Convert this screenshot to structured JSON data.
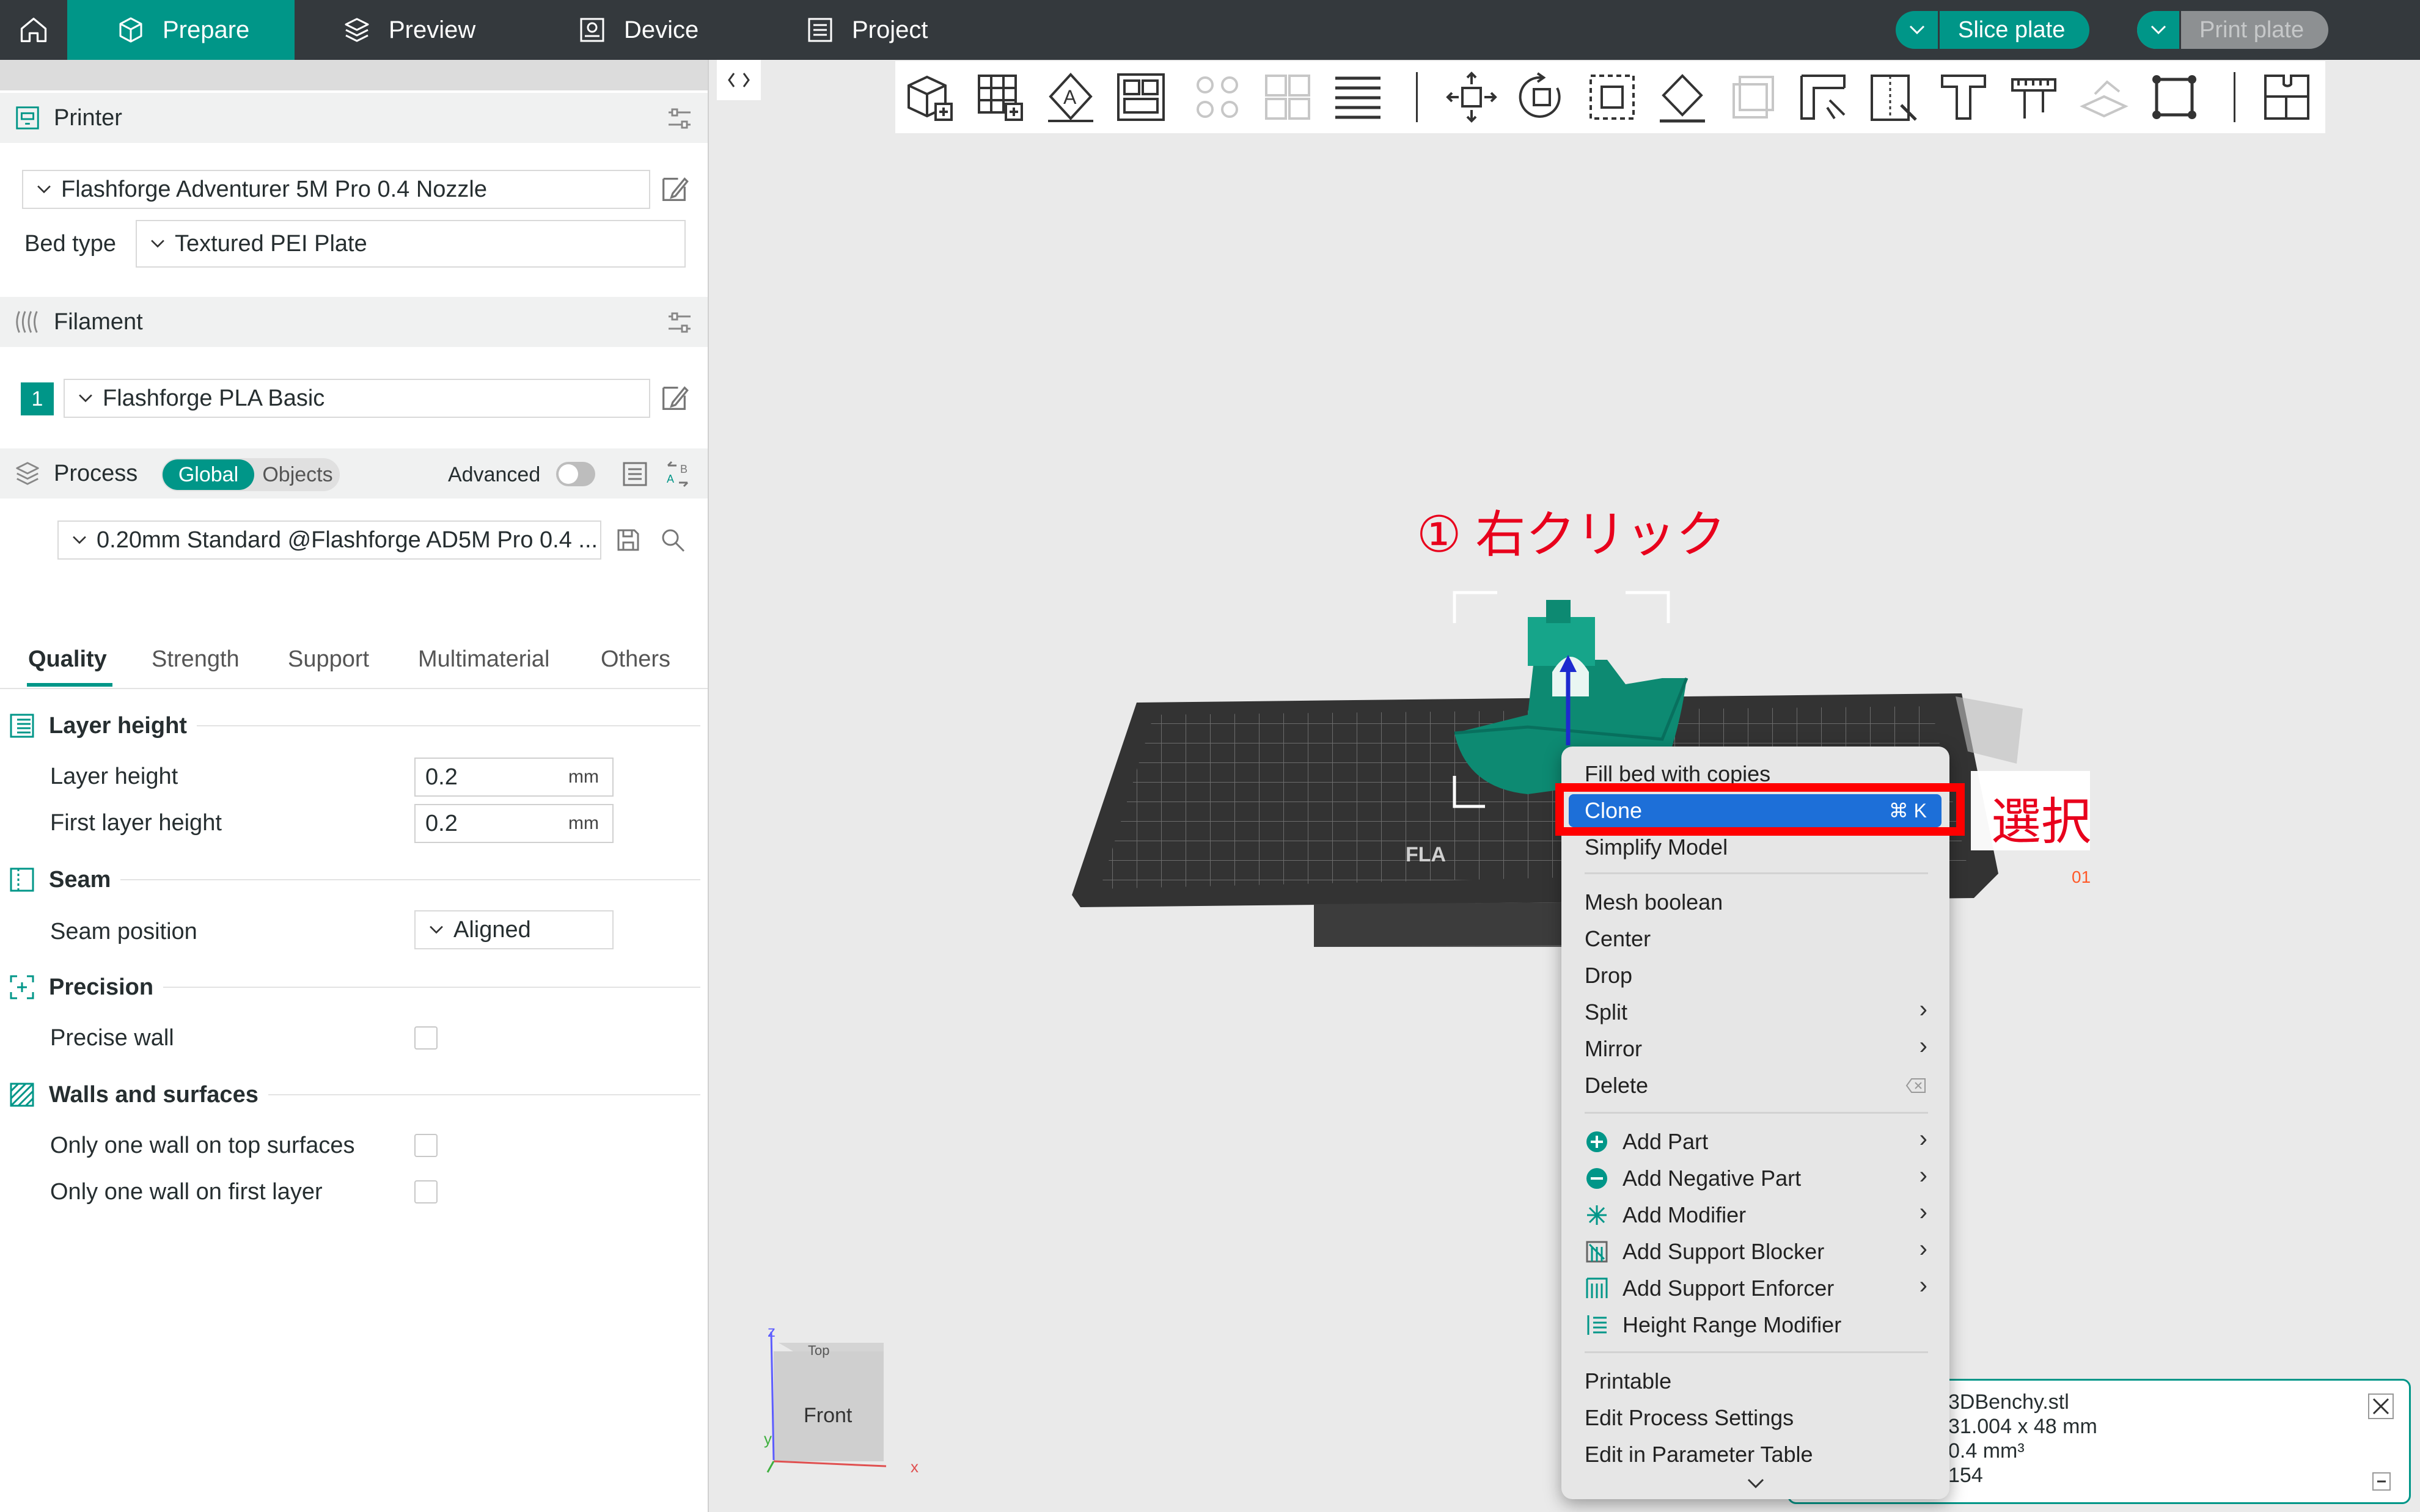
{
  "topbar": {
    "tabs": [
      {
        "label": "Prepare"
      },
      {
        "label": "Preview"
      },
      {
        "label": "Device"
      },
      {
        "label": "Project"
      }
    ],
    "slice_label": "Slice plate",
    "print_label": "Print plate"
  },
  "printer": {
    "title": "Printer",
    "preset": "Flashforge Adventurer 5M Pro 0.4 Nozzle",
    "bed_type_label": "Bed type",
    "bed_type": "Textured PEI Plate"
  },
  "filament": {
    "title": "Filament",
    "slot": "1",
    "preset": "Flashforge PLA Basic"
  },
  "process": {
    "title": "Process",
    "global_label": "Global",
    "objects_label": "Objects",
    "advanced_label": "Advanced",
    "preset": "0.20mm Standard @Flashforge AD5M Pro 0.4 ..."
  },
  "tabs": [
    "Quality",
    "Strength",
    "Support",
    "Multimaterial",
    "Others"
  ],
  "settings": {
    "layer_height_group": "Layer height",
    "layer_height_label": "Layer height",
    "layer_height_value": "0.2",
    "first_layer_height_label": "First layer height",
    "first_layer_height_value": "0.2",
    "unit": "mm",
    "seam_group": "Seam",
    "seam_position_label": "Seam position",
    "seam_position_value": "Aligned",
    "precision_group": "Precision",
    "precise_wall_label": "Precise wall",
    "walls_group": "Walls and surfaces",
    "one_wall_top_label": "Only one wall on top surfaces",
    "one_wall_first_label": "Only one wall on first layer"
  },
  "annotations": {
    "step1": "① 右クリック",
    "select": "選択"
  },
  "context_menu": {
    "items": [
      {
        "label": "Fill bed with copies"
      },
      {
        "label": "Clone",
        "shortcut": "⌘ K"
      },
      {
        "label": "Simplify Model"
      },
      {
        "label": "Mesh boolean"
      },
      {
        "label": "Center"
      },
      {
        "label": "Drop"
      },
      {
        "label": "Split"
      },
      {
        "label": "Mirror"
      },
      {
        "label": "Delete"
      },
      {
        "label": "Add Part"
      },
      {
        "label": "Add Negative Part"
      },
      {
        "label": "Add Modifier"
      },
      {
        "label": "Add Support Blocker"
      },
      {
        "label": "Add Support Enforcer"
      },
      {
        "label": "Height Range Modifier"
      },
      {
        "label": "Printable"
      },
      {
        "label": "Edit Process Settings"
      },
      {
        "label": "Edit in Parameter Table"
      }
    ]
  },
  "viewcube": {
    "front_label": "Front",
    "top_label": "Top",
    "x_label": "x",
    "z_label": "z",
    "y_label": "y"
  },
  "info": {
    "name": "3DBenchy.stl",
    "size": "31.004 x 48 mm",
    "volume": "0.4 mm³",
    "facets": "154"
  },
  "colors": {
    "accent": "#009688",
    "topbar": "#34393d",
    "highlight": "#1d6fd8",
    "annotation": "#e8001c"
  }
}
